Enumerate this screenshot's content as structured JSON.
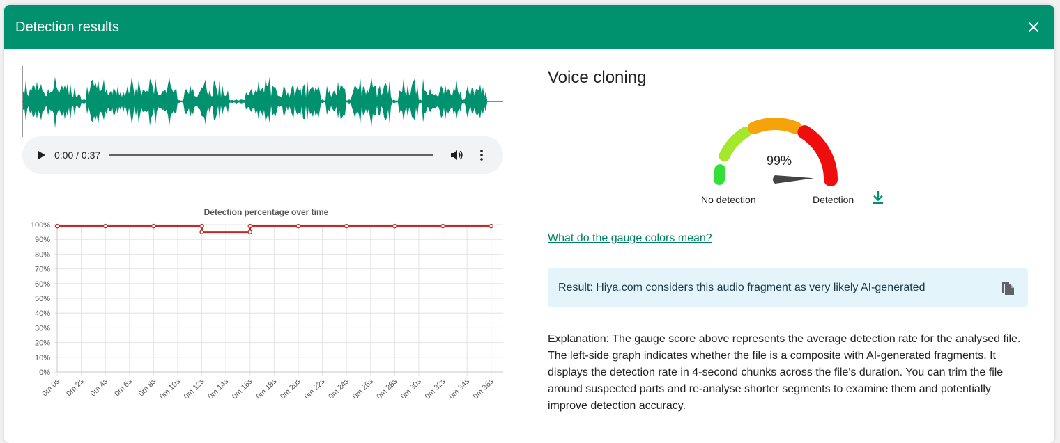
{
  "dialog": {
    "title": "Detection results",
    "close_icon": "close-icon"
  },
  "player": {
    "time": "0:00 / 0:37",
    "icons": [
      "play-icon",
      "volume-icon",
      "more-vert-icon"
    ]
  },
  "chart_data": {
    "type": "line",
    "title": "Detection percentage over time",
    "xlabel": "",
    "ylabel": "",
    "x_ticks": [
      "0m 0s",
      "0m 2s",
      "0m 4s",
      "0m 6s",
      "0m 8s",
      "0m 10s",
      "0m 12s",
      "0m 14s",
      "0m 16s",
      "0m 18s",
      "0m 20s",
      "0m 22s",
      "0m 24s",
      "0m 26s",
      "0m 28s",
      "0m 30s",
      "0m 32s",
      "0m 34s",
      "0m 36s"
    ],
    "y_ticks": [
      "0%",
      "10%",
      "20%",
      "30%",
      "40%",
      "50%",
      "60%",
      "70%",
      "80%",
      "90%",
      "100%"
    ],
    "ylim": [
      0,
      100
    ],
    "xlim": [
      0,
      37
    ],
    "grid": true,
    "series": [
      {
        "color": "#c62828",
        "points": [
          {
            "x": 0,
            "y": 99
          },
          {
            "x": 4,
            "y": 99
          },
          {
            "x": 8,
            "y": 99
          },
          {
            "x": 12,
            "y": 99
          },
          {
            "x": 12,
            "y": 95
          },
          {
            "x": 16,
            "y": 95
          },
          {
            "x": 16,
            "y": 99
          },
          {
            "x": 20,
            "y": 99
          },
          {
            "x": 24,
            "y": 99
          },
          {
            "x": 28,
            "y": 99
          },
          {
            "x": 32,
            "y": 99
          },
          {
            "x": 36,
            "y": 99
          }
        ]
      }
    ]
  },
  "voice": {
    "title": "Voice cloning",
    "gauge_value": "99%",
    "gauge_level": 0.99,
    "label_left": "No detection",
    "label_right": "Detection",
    "download_icon": "download-icon",
    "colors": {
      "low": "#33e03a",
      "low_mid": "#a4e82b",
      "mid": "#f5a30b",
      "high": "#ef0d0d",
      "needle": "#444444"
    }
  },
  "help_link": "What do the gauge colors mean?",
  "result": {
    "text": "Result: Hiya.com considers this audio fragment as very likely AI-generated",
    "copy_icon": "copy-icon"
  },
  "explanation": "Explanation: The gauge score above represents the average detection rate for the analysed file. The left-side graph indicates whether the file is a composite with AI-generated fragments. It displays the detection rate in 4-second chunks across the file's duration. You can trim the file around suspected parts and re-analyse shorter segments to examine them and potentially improve detection accuracy.",
  "colors": {
    "header": "#00916e",
    "waveform": "#00916e",
    "accent_link": "#00805f"
  }
}
